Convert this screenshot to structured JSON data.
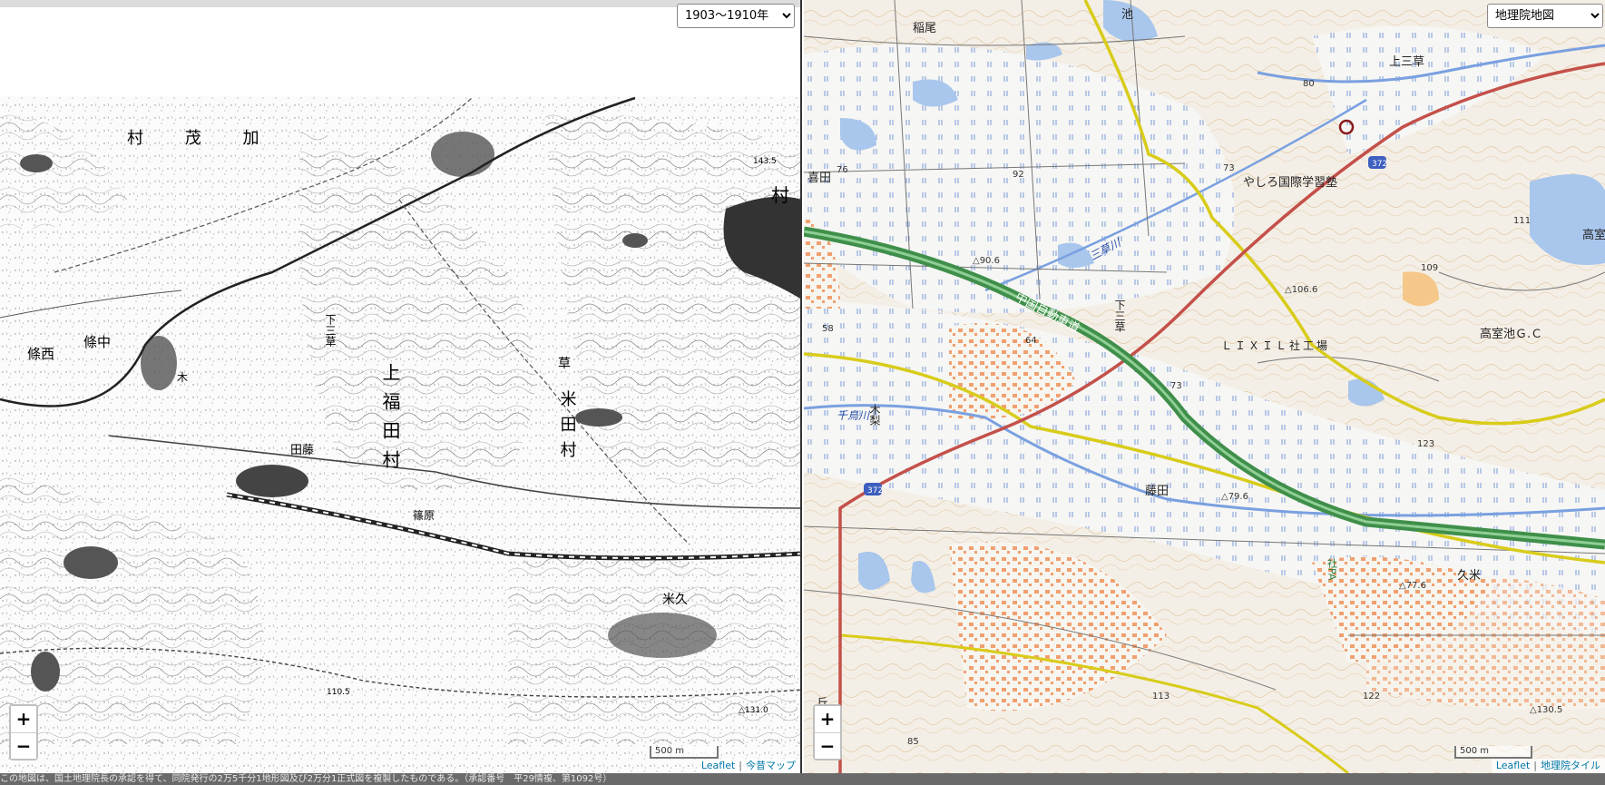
{
  "left_map": {
    "layer_select": {
      "selected": "1903～1910年"
    },
    "zoom": {
      "in": "+",
      "out": "−"
    },
    "scale": "500 m",
    "attribution": {
      "leaflet": "Leaflet",
      "source": "今昔マップ"
    },
    "labels": {
      "kamo_village": "村 茂 加",
      "mura": "村",
      "nakajo": "條中",
      "nishijo": "條西",
      "fujita": "田藤",
      "shimomikusa": "下三草",
      "kami_fukuda_village": "上福田村",
      "yoneda_village": "米田村",
      "kume": "米久",
      "shinohara": "篠原",
      "kusa": "草",
      "ki": "木",
      "elev_1": "△131.0",
      "elev_2": "110.5",
      "elev_3": "143.5"
    }
  },
  "right_map": {
    "layer_select": {
      "selected": "地理院地図"
    },
    "zoom": {
      "in": "+",
      "out": "−"
    },
    "scale": "500 m",
    "attribution": {
      "leaflet": "Leaflet",
      "source": "地理院タイル"
    },
    "labels": {
      "inao": "稲尾",
      "ike": "池",
      "kitada": "喜田",
      "kamimikusa": "上三草",
      "yashiro_school": "やしろ国際学習塾",
      "mikusa_river": "三草川",
      "chugoku_expressway": "中国自動車道",
      "shimomikusa": "下三草",
      "lixil_factory": "ＬＩＸＩＬ社工場",
      "takamuro_gc": "高室池Ｇ.Ｃ",
      "takamuro": "高室",
      "kinashi": "木梨",
      "chidori_river": "千鳥川",
      "fujita": "藤田",
      "kume": "久米",
      "oka": "丘",
      "sha_pa": "社PA",
      "route": "372",
      "elev_80": "80",
      "elev_73": "73",
      "elev_76": "76",
      "elev_92": "92",
      "elev_906": "△90.6",
      "elev_1066": "△106.6",
      "elev_109": "109",
      "elev_111": "111",
      "elev_58": "58",
      "elev_64": "64",
      "elev_73b": "73",
      "elev_123": "123",
      "elev_79": "△79.6",
      "elev_77": "△77.6",
      "elev_122": "122",
      "elev_113": "113",
      "elev_85": "85",
      "elev_1305": "△130.5"
    }
  },
  "footer": "この地図は、国土地理院長の承認を得て、同院発行の2万5千分1地形図及び2万分1正式図を複製したものである。（承認番号　平29情複、第1092号）",
  "colors": {
    "expressway": "#3f8f4a",
    "national_road": "#c4504a",
    "prefectural_road": "#d8cc1a",
    "water": "#a9c6ec",
    "building": "#f0a070"
  }
}
